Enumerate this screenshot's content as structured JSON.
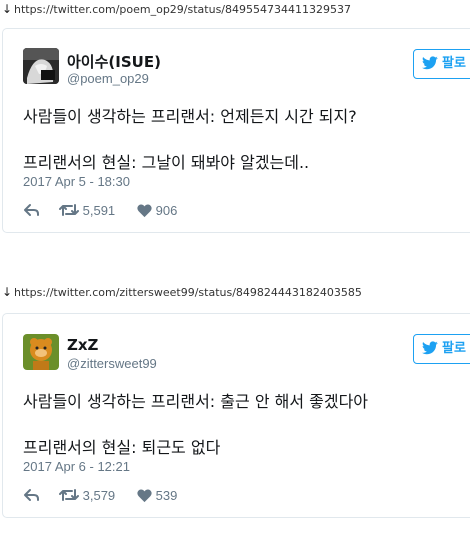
{
  "tweets": [
    {
      "source_url": "https://twitter.com/poem_op29/status/849554734411329537",
      "display_name": "아이수(ISUE)",
      "handle": "@poem_op29",
      "follow_label": "팔로",
      "line1": "사람들이 생각하는 프리랜서: 언제든지 시간 되지?",
      "line2": "프리랜서의 현실: 그날이 돼봐야 알겠는데..",
      "timestamp": "2017 Apr 5 - 18:30",
      "retweets": "5,591",
      "likes": "906"
    },
    {
      "source_url": "https://twitter.com/zittersweet99/status/849824443182403585",
      "display_name": "ZxZ",
      "handle": "@zittersweet99",
      "follow_label": "팔로",
      "line1": "사람들이 생각하는 프리랜서: 출근 안 해서 좋겠다아",
      "line2": "프리랜서의 현실: 퇴근도 없다",
      "timestamp": "2017 Apr 6 - 12:21",
      "retweets": "3,579",
      "likes": "539"
    }
  ],
  "colors": {
    "accent": "#1da1f2",
    "muted": "#657786",
    "border": "#e1e8ed"
  }
}
